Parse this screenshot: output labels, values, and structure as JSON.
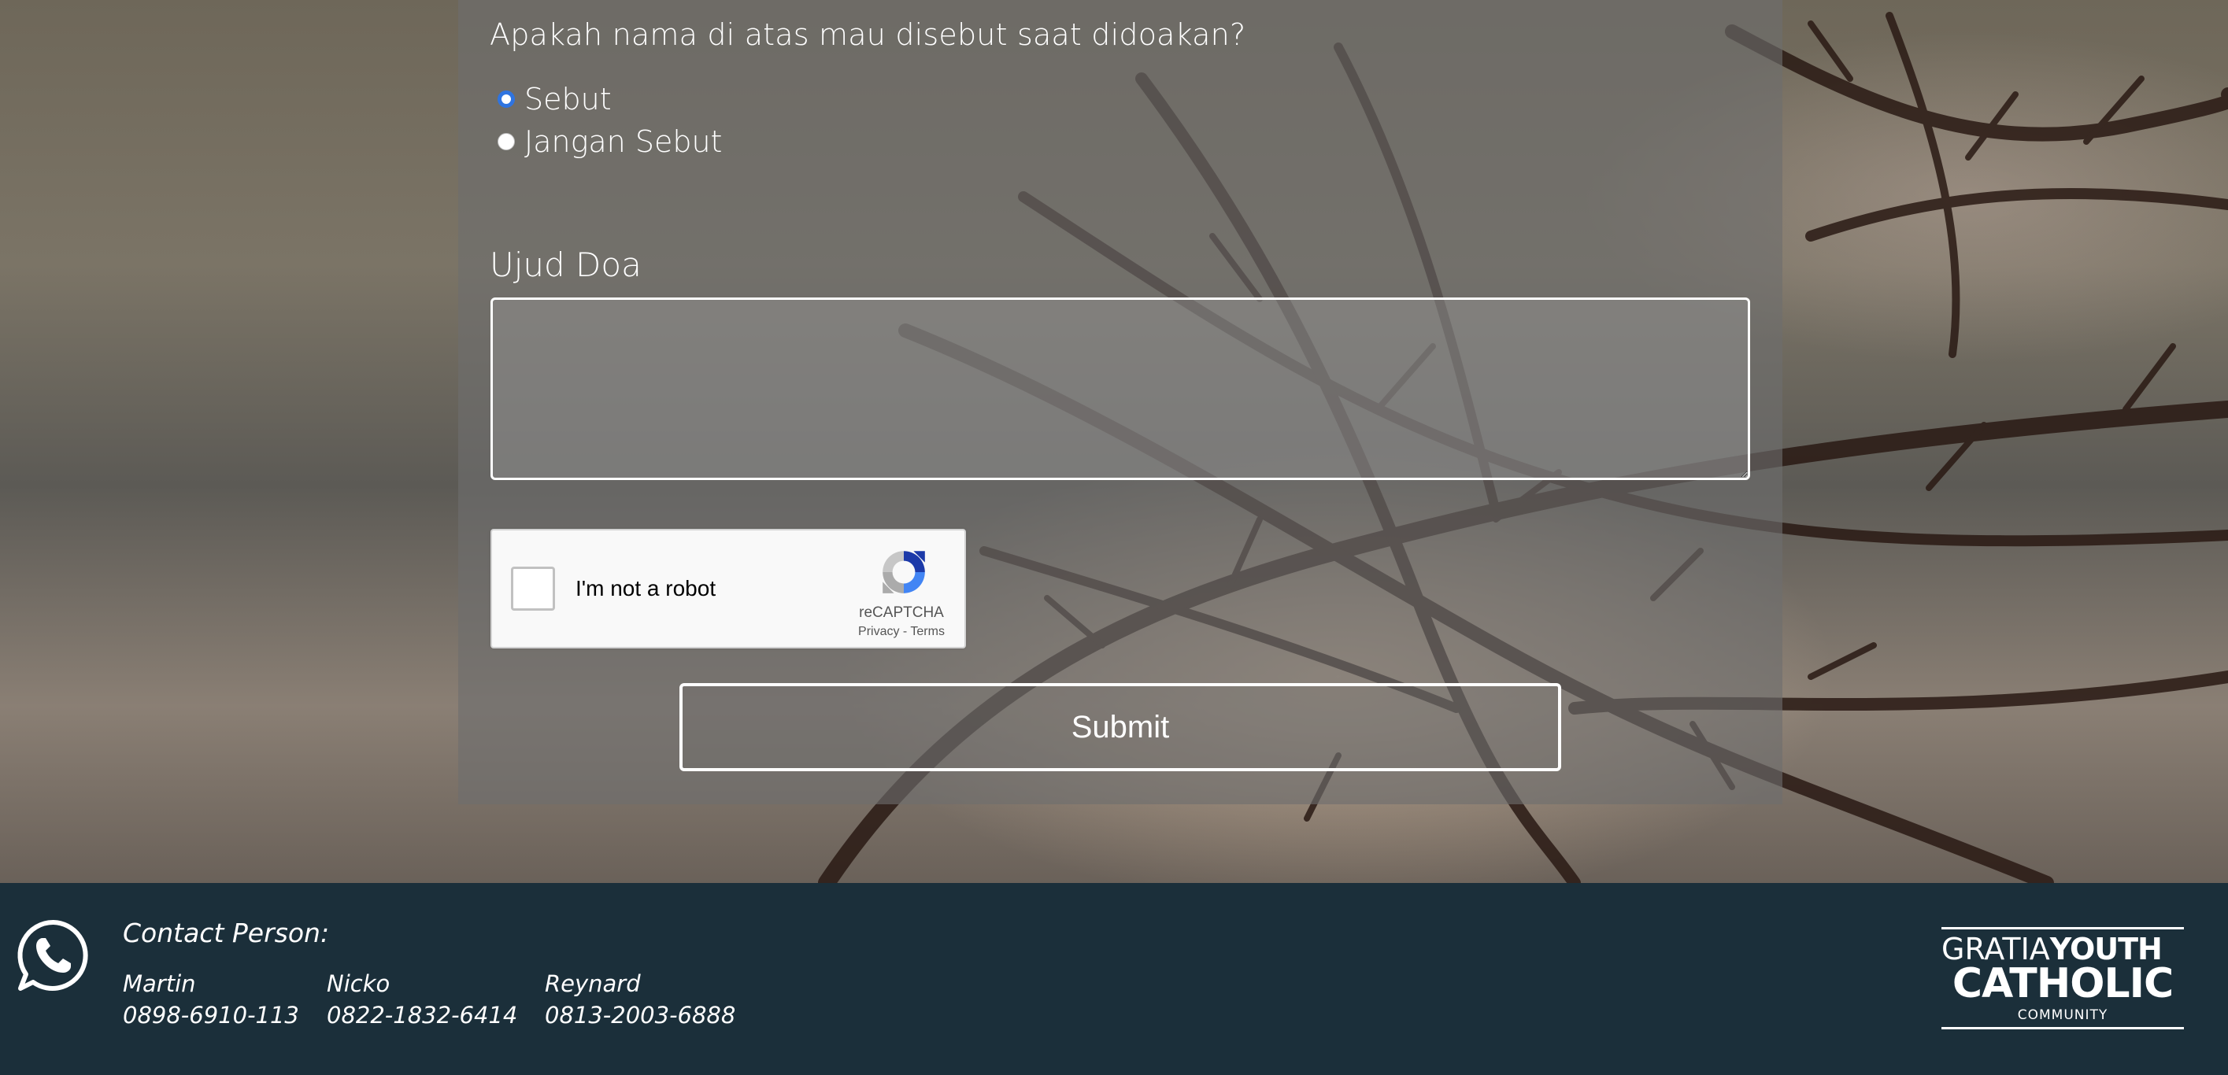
{
  "form": {
    "question": "Apakah nama di atas mau disebut saat didoakan?",
    "options": [
      {
        "label": "Sebut",
        "checked": true
      },
      {
        "label": "Jangan Sebut",
        "checked": false
      }
    ],
    "intention_label": "Ujud Doa",
    "intention_value": "",
    "submit_label": "Submit"
  },
  "recaptcha": {
    "label": "I'm not a robot",
    "brand": "reCAPTCHA",
    "privacy": "Privacy",
    "separator": " - ",
    "terms": "Terms"
  },
  "footer": {
    "contact_title": "Contact Person:",
    "contacts": [
      {
        "name": "Martin",
        "phone": "0898-6910-113"
      },
      {
        "name": "Nicko",
        "phone": "0822-1832-6414"
      },
      {
        "name": "Reynard",
        "phone": "0813-2003-6888"
      }
    ],
    "logo": {
      "line1_light": "GRATIA",
      "line1_bold": "YOUTH",
      "line2": "CATHOLIC",
      "line3": "COMMUNITY"
    }
  },
  "colors": {
    "footer_bg": "#1b2f3a",
    "radio_accent": "#2f74e0",
    "panel_overlay": "rgba(110,110,110,0.62)"
  },
  "icons": {
    "whatsapp": "whatsapp-icon",
    "recaptcha": "recaptcha-logo-icon"
  }
}
